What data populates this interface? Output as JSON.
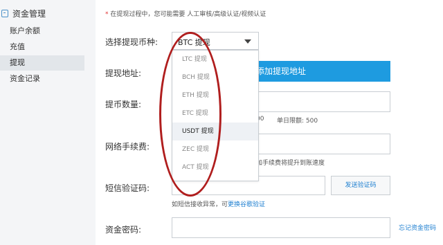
{
  "sidebar": {
    "title": "资金管理",
    "items": [
      {
        "label": "账户余额",
        "active": false
      },
      {
        "label": "充值",
        "active": false
      },
      {
        "label": "提现",
        "active": true
      },
      {
        "label": "资金记录",
        "active": false
      }
    ]
  },
  "notice": {
    "star": "*",
    "text": "在提现过程中，您可能需要 人工审核/高级认证/视频认证"
  },
  "form": {
    "currency_label": "选择提现币种:",
    "currency_value": "BTC 提现",
    "address_label": "提现地址:",
    "add_address_button": "添加提现地址",
    "amount_label": "提币数量:",
    "amount_hint_a": "00",
    "amount_hint_b": "单日限额: 500",
    "fee_label": "网络手续费:",
    "fee_hint": "加手续费将提升到账速度",
    "sms_label": "短信验证码:",
    "send_code_button": "发送验证码",
    "sms_hint_text": "如短信接收异常，可",
    "sms_hint_link": "更换谷歌验证",
    "password_label": "资金密码:",
    "forgot_password": "忘记资金密码"
  },
  "dropdown": {
    "options": [
      {
        "label": "LTC 提现",
        "highlighted": false
      },
      {
        "label": "BCH 提现",
        "highlighted": false
      },
      {
        "label": "ETH 提现",
        "highlighted": false
      },
      {
        "label": "ETC 提现",
        "highlighted": false
      },
      {
        "label": "USDT 提现",
        "highlighted": true
      },
      {
        "label": "ZEC 提现",
        "highlighted": false
      },
      {
        "label": "ACT 提现",
        "highlighted": false
      }
    ]
  },
  "colors": {
    "accent": "#1e9be0",
    "link": "#1e7fd0",
    "annotation": "#b01e1e"
  }
}
